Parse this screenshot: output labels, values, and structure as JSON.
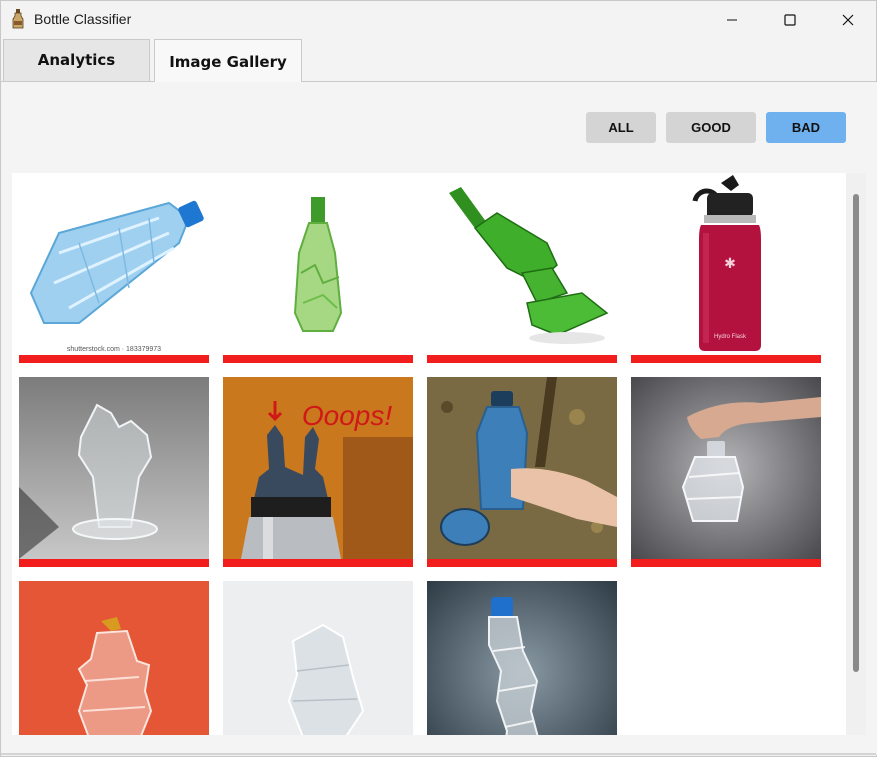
{
  "window": {
    "title": "Bottle Classifier",
    "controls": {
      "minimize": "minimize-icon",
      "maximize": "maximize-icon",
      "close": "close-icon"
    }
  },
  "tabs": [
    {
      "label": "Analytics",
      "selected": false
    },
    {
      "label": "Image Gallery",
      "selected": true
    }
  ],
  "filters": {
    "all": "ALL",
    "good": "GOOD",
    "bad": "BAD",
    "active": "BAD",
    "active_color": "#6fb1ee",
    "inactive_color": "#d4d4d4"
  },
  "gallery": {
    "label_color_bad": "#f21d1d",
    "items": [
      {
        "subject": "crushed plastic water bottle",
        "caption": "shutterstock.com · 183379973",
        "label": "bad"
      },
      {
        "subject": "broken green glass bottle",
        "label": "bad"
      },
      {
        "subject": "shattered green glass bottle pieces",
        "label": "bad"
      },
      {
        "subject": "pink insulated bottle",
        "brand_text": "Hydro Flask",
        "label": "bad"
      },
      {
        "subject": "broken clear glass bottle",
        "label": "bad"
      },
      {
        "subject": "broken bottle cap",
        "overlay_text": "Ooops!",
        "label": "bad"
      },
      {
        "subject": "blue plastic bottle held in hand",
        "label": "bad"
      },
      {
        "subject": "crumpled plastic bottle held by fingers",
        "label": "bad"
      },
      {
        "subject": "crushed clear bottle on red background",
        "label": "bad"
      },
      {
        "subject": "crumpled plastic bottle on white",
        "label": "bad"
      },
      {
        "subject": "crushed plastic bottle with blue cap",
        "label": "bad"
      }
    ]
  }
}
